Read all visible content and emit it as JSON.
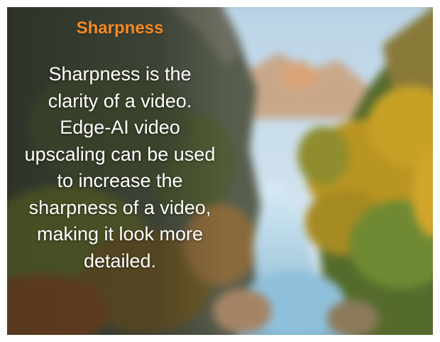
{
  "card": {
    "title": "Sharpness",
    "description": "Sharpness is the clarity of a video. Edge-AI video upscaling can be used to increase the sharpness of a video, making it look more detailed."
  },
  "colors": {
    "title": "#f58a25",
    "text": "#ffffff"
  },
  "background": {
    "subject": "blurred canyon river with autumn trees"
  }
}
